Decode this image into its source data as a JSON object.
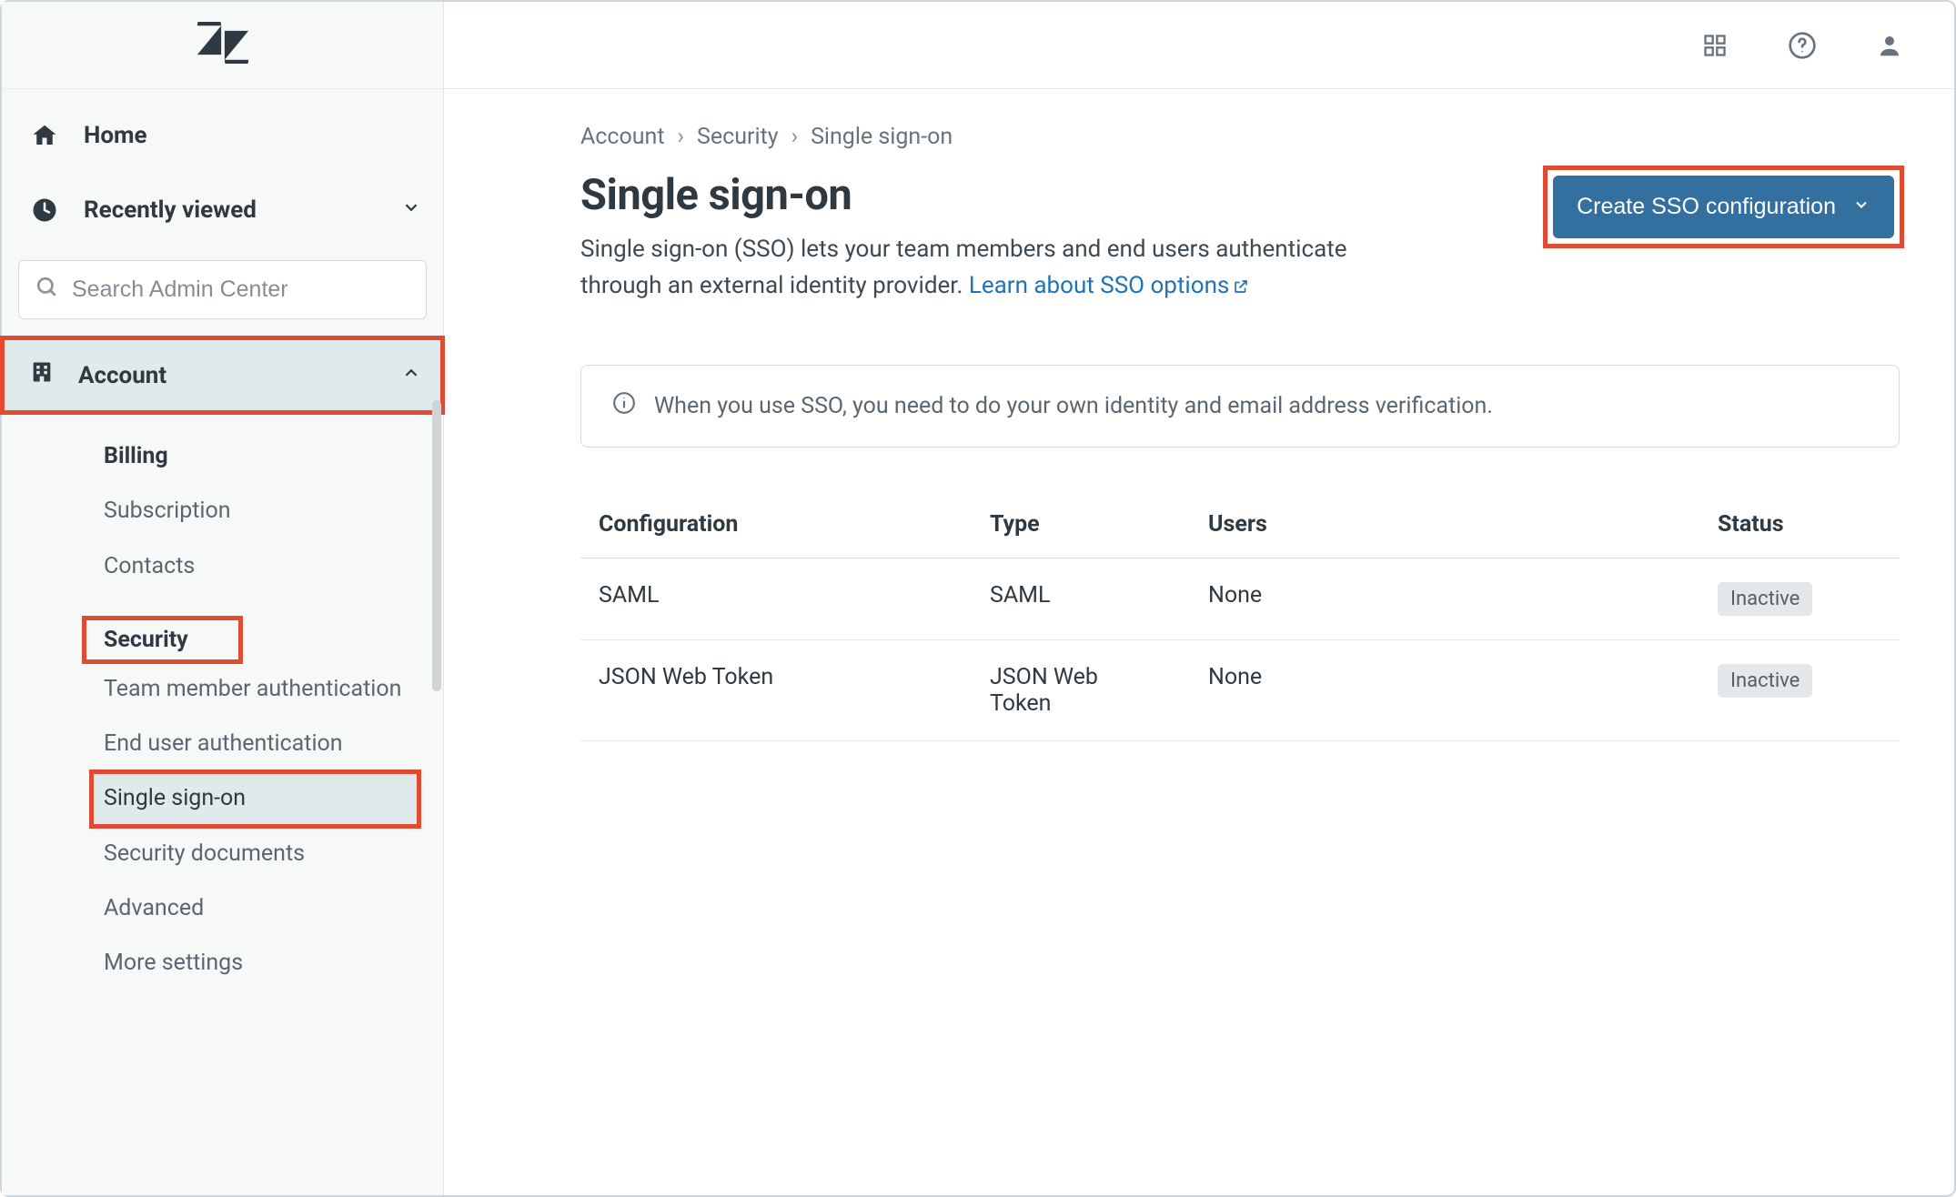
{
  "sidebar": {
    "home_label": "Home",
    "recent_label": "Recently viewed",
    "search_placeholder": "Search Admin Center",
    "section_label": "Account",
    "sub_items": [
      {
        "label": "Billing"
      },
      {
        "label": "Subscription"
      },
      {
        "label": "Contacts"
      }
    ],
    "security_group_label": "Security",
    "security_items": [
      {
        "label": "Team member authentication"
      },
      {
        "label": "End user authentication"
      },
      {
        "label": "Single sign-on"
      },
      {
        "label": "Security documents"
      },
      {
        "label": "Advanced"
      },
      {
        "label": "More settings"
      }
    ]
  },
  "breadcrumb": {
    "a": "Account",
    "b": "Security",
    "c": "Single sign-on"
  },
  "page": {
    "title": "Single sign-on",
    "desc_text": "Single sign-on (SSO) lets your team members and end users authenticate through an external identity provider. ",
    "link_text": "Learn about SSO options",
    "create_btn": "Create SSO configuration"
  },
  "banner": {
    "text": "When you use SSO, you need to do your own identity and email address verification."
  },
  "table": {
    "headers": {
      "config": "Configuration",
      "type": "Type",
      "users": "Users",
      "status": "Status"
    },
    "rows": [
      {
        "config": "SAML",
        "type": "SAML",
        "users": "None",
        "status": "Inactive"
      },
      {
        "config": "JSON Web Token",
        "type": "JSON Web Token",
        "users": "None",
        "status": "Inactive"
      }
    ]
  }
}
